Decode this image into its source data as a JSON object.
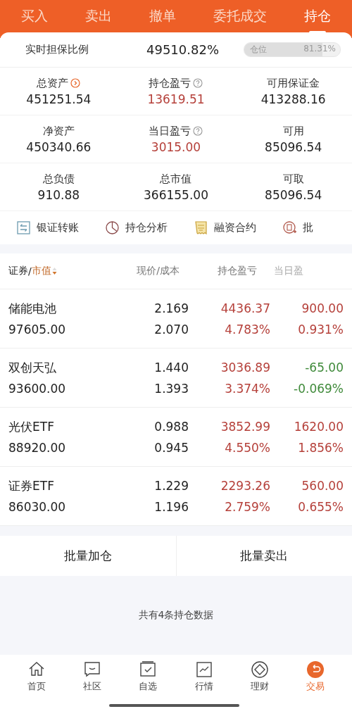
{
  "tabs": [
    {
      "label": "买入",
      "selected": false
    },
    {
      "label": "卖出",
      "selected": false
    },
    {
      "label": "撤单",
      "selected": false
    },
    {
      "label": "委托成交",
      "selected": false
    },
    {
      "label": "持仓",
      "selected": true
    }
  ],
  "ratio": {
    "label": "实时担保比例",
    "value": "49510.82%",
    "position_label": "仓位",
    "position_value": "81.31%",
    "level": 0.8131
  },
  "metrics": [
    {
      "label": "总资产",
      "value": "451251.54",
      "kind": "link"
    },
    {
      "label": "持仓盈亏",
      "value": "13619.51",
      "kind": "help",
      "color": "#b5403a"
    },
    {
      "label": "可用保证金",
      "value": "413288.16",
      "kind": "plain"
    },
    {
      "label": "净资产",
      "value": "450340.66",
      "kind": "plain"
    },
    {
      "label": "当日盈亏",
      "value": "3015.00",
      "kind": "help",
      "color": "#b5403a"
    },
    {
      "label": "可用",
      "value": "85096.54",
      "kind": "plain"
    },
    {
      "label": "总负债",
      "value": "910.88",
      "kind": "plain"
    },
    {
      "label": "总市值",
      "value": "366155.00",
      "kind": "plain"
    },
    {
      "label": "可取",
      "value": "85096.54",
      "kind": "plain"
    }
  ],
  "tools": [
    {
      "label": "银证转账",
      "kind": "transfer"
    },
    {
      "label": "持仓分析",
      "kind": "pie"
    },
    {
      "label": "融资合约",
      "kind": "contract"
    },
    {
      "label": "批",
      "kind": "batch"
    }
  ],
  "table": {
    "columns": [
      "证券",
      "/",
      "市值",
      "现价/成本",
      "持仓盈亏",
      "当日盈"
    ],
    "rows": [
      {
        "name": "储能电池",
        "market_value": "97605.00",
        "price": "2.169",
        "cost": "2.070",
        "pl": {
          "value": "4436.37",
          "pct": "4.783%",
          "color": "#b5403a"
        },
        "day": {
          "value": "900.00",
          "pct": "0.931%",
          "color": "#b5403a"
        }
      },
      {
        "name": "双创天弘",
        "market_value": "93600.00",
        "price": "1.440",
        "cost": "1.393",
        "pl": {
          "value": "3036.89",
          "pct": "3.374%",
          "color": "#b5403a"
        },
        "day": {
          "value": "-65.00",
          "pct": "-0.069%",
          "color": "#3f8a3a"
        }
      },
      {
        "name": "光伏ETF",
        "market_value": "88920.00",
        "price": "0.988",
        "cost": "0.945",
        "pl": {
          "value": "3852.99",
          "pct": "4.550%",
          "color": "#b5403a"
        },
        "day": {
          "value": "1620.00",
          "pct": "1.856%",
          "color": "#b5403a"
        }
      },
      {
        "name": "证券ETF",
        "market_value": "86030.00",
        "price": "1.229",
        "cost": "1.196",
        "pl": {
          "value": "2293.26",
          "pct": "2.759%",
          "color": "#b5403a"
        },
        "day": {
          "value": "560.00",
          "pct": "0.655%",
          "color": "#b5403a"
        }
      }
    ]
  },
  "actions": [
    "批量加仓",
    "批量卖出"
  ],
  "summary": "共有4条持仓数据",
  "nav": [
    {
      "label": "首页",
      "kind": "home",
      "selected": false
    },
    {
      "label": "社区",
      "kind": "chat",
      "selected": false
    },
    {
      "label": "自选",
      "kind": "check",
      "selected": false
    },
    {
      "label": "行情",
      "kind": "chart",
      "selected": false
    },
    {
      "label": "理财",
      "kind": "diamond",
      "selected": false
    },
    {
      "label": "交易",
      "kind": "trade",
      "selected": true
    }
  ]
}
